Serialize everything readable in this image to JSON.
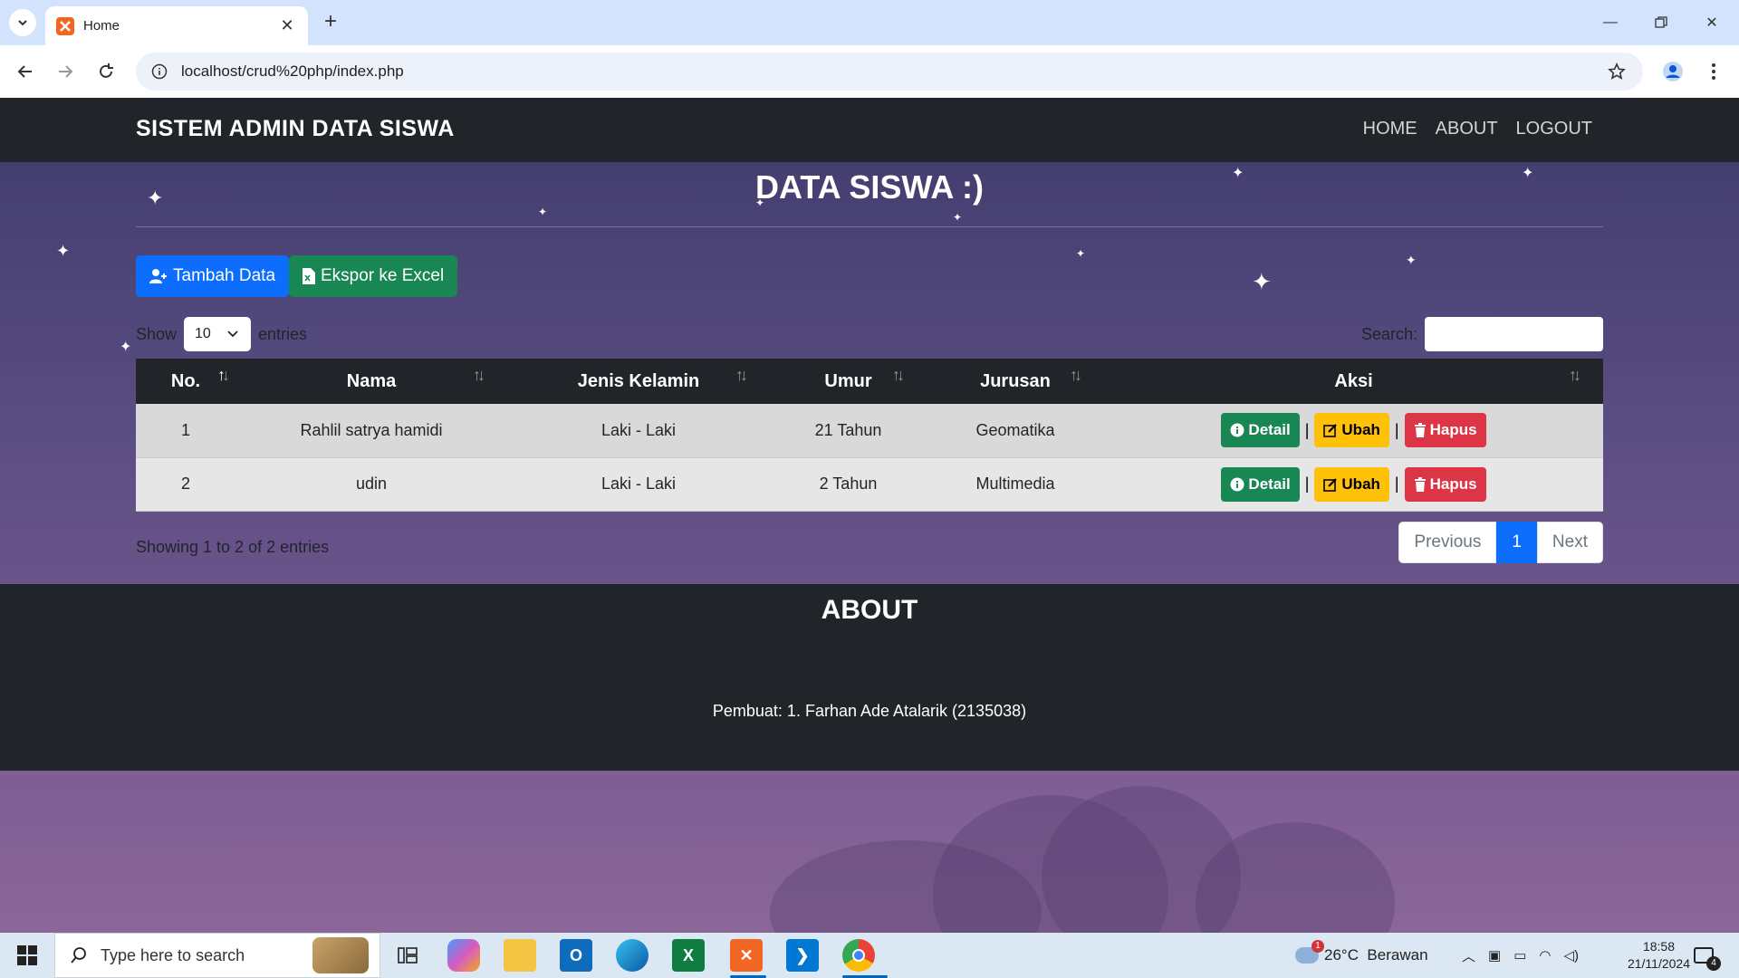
{
  "browser": {
    "tab_title": "Home",
    "url": "localhost/crud%20php/index.php"
  },
  "navbar": {
    "brand": "SISTEM ADMIN DATA SISWA",
    "links": [
      "HOME",
      "ABOUT",
      "LOGOUT"
    ]
  },
  "page": {
    "title": "DATA SISWA :)",
    "add_button": "Tambah Data",
    "export_button": "Ekspor ke Excel"
  },
  "datatable": {
    "show_label": "Show",
    "page_length": "10",
    "entries_label": "entries",
    "search_label": "Search:",
    "search_value": "",
    "columns": [
      "No.",
      "Nama",
      "Jenis Kelamin",
      "Umur",
      "Jurusan",
      "Aksi"
    ],
    "rows": [
      {
        "no": "1",
        "nama": "Rahlil satrya hamidi",
        "jk": "Laki - Laki",
        "umur": "21 Tahun",
        "jurusan": "Geomatika"
      },
      {
        "no": "2",
        "nama": "udin",
        "jk": "Laki - Laki",
        "umur": "2 Tahun",
        "jurusan": "Multimedia"
      }
    ],
    "actions": {
      "detail": "Detail",
      "ubah": "Ubah",
      "hapus": "Hapus",
      "separator": "|"
    },
    "info": "Showing 1 to 2 of 2 entries",
    "pager": {
      "previous": "Previous",
      "current": "1",
      "next": "Next"
    }
  },
  "about": {
    "title": "ABOUT",
    "credit": "Pembuat: 1. Farhan Ade Atalarik (2135038)"
  },
  "taskbar": {
    "search_placeholder": "Type here to search",
    "weather": "26°C  Berawan",
    "time": "18:58",
    "date": "21/11/2024",
    "notification_count": "4",
    "weather_badge": "1"
  }
}
